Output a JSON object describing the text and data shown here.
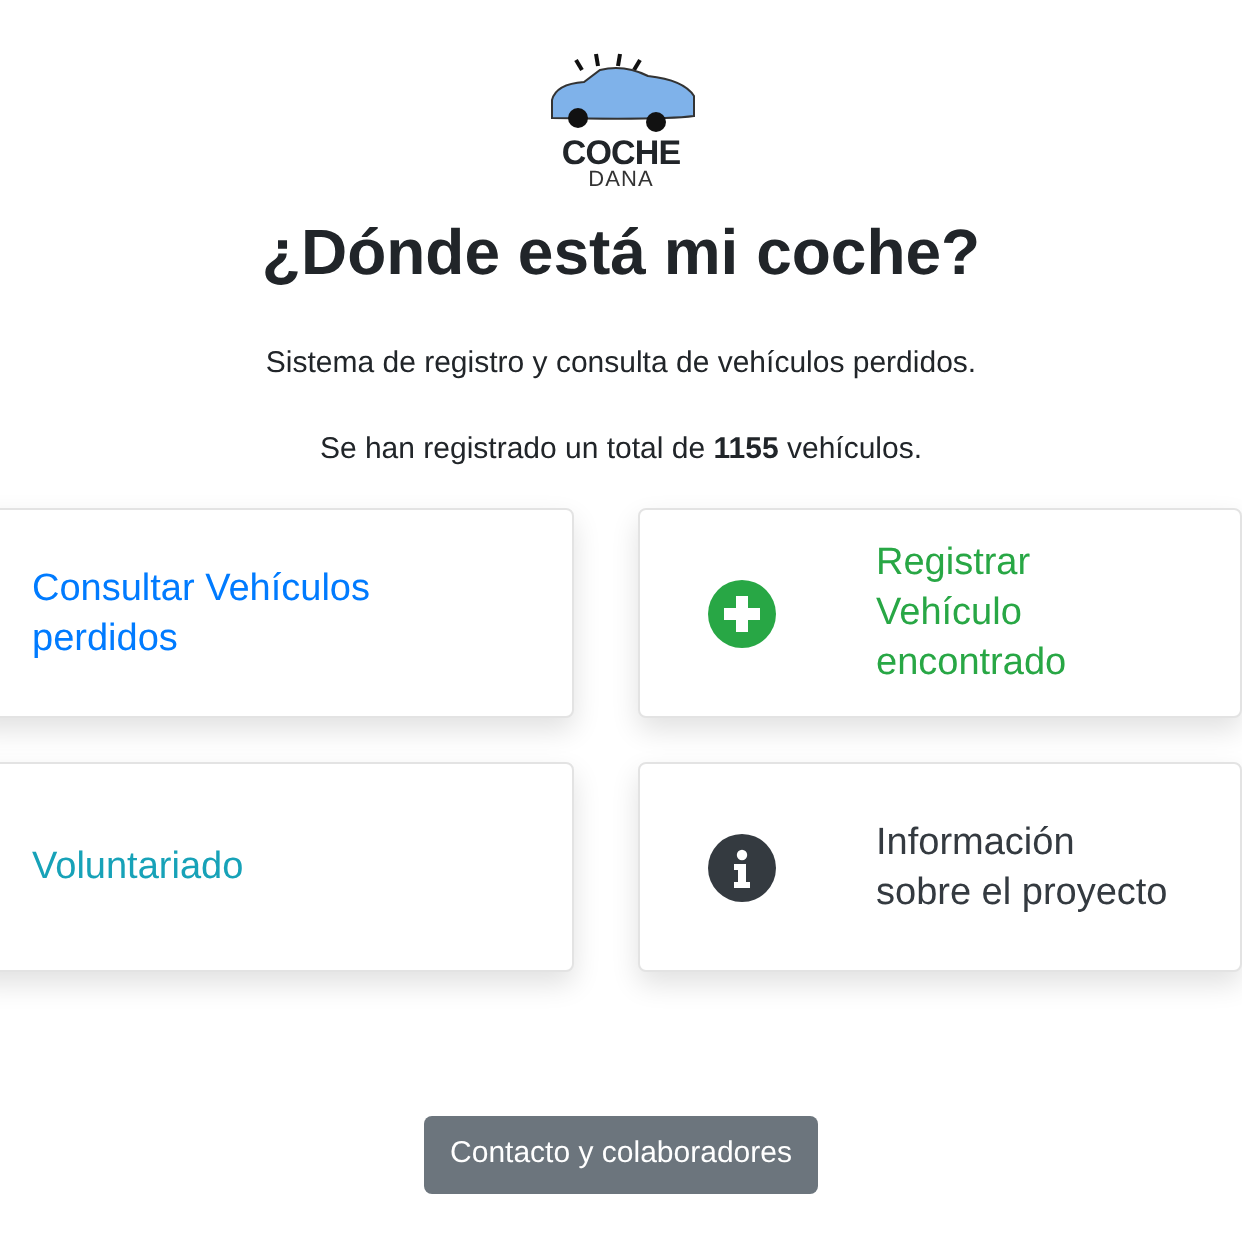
{
  "logo": {
    "line_1": "COCHE",
    "line_2": "DANA"
  },
  "title": "¿Dónde está mi coche?",
  "subtitle": "Sistema de registro y consulta de vehículos perdidos.",
  "total": "Se han registrado un total de **1155** vehículos.",
  "cards": [
    {
      "label": "Consultar Vehículos perdidos",
      "color": "#007bff",
      "kind": "link"
    },
    {
      "label": "Registrar Vehículo encontrado",
      "color": "#28a745",
      "kind": "plus"
    },
    {
      "label": "Voluntariado",
      "color": "#17a2b8",
      "kind": "link"
    },
    {
      "label": "Información sobre el proyecto",
      "color": "#343a40",
      "kind": "info"
    }
  ],
  "contact_button": "Contacto y colaboradores"
}
